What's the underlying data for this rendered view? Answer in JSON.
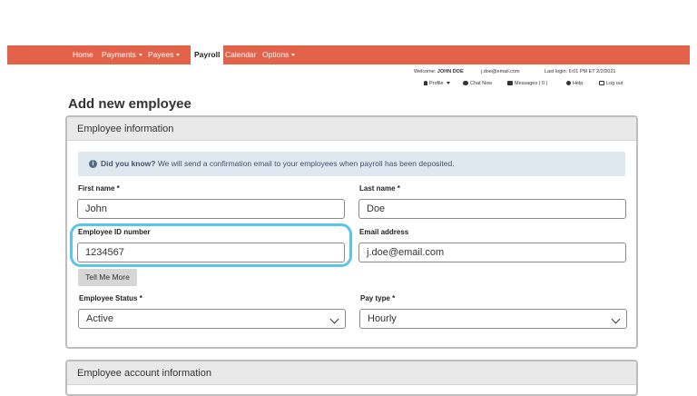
{
  "nav": {
    "home": "Home",
    "payments": "Payments",
    "payees": "Payees",
    "payroll": "Payroll",
    "calendar": "Calendar",
    "options": "Options"
  },
  "util": {
    "welcome_label": "Welcome:",
    "user_name": "JOHN DOE",
    "email": "j.doe@email.com",
    "last_login": "Last login: 6:01 PM ET  2/2/2021",
    "profile": "Profile",
    "chat": "Chat Now",
    "messages": "Messages ( 0 )",
    "help": "Help",
    "logout": "Log out"
  },
  "page": {
    "title": "Add new employee"
  },
  "employee_info": {
    "heading": "Employee information",
    "notice_bold": "Did you know?",
    "notice_text": " We will send a confirmation email to your employees when payroll has been deposited.",
    "first_name_label": "First name  *",
    "first_name_value": "John",
    "last_name_label": "Last name  *",
    "last_name_value": "Doe",
    "employee_id_label": "Employee ID number",
    "employee_id_value": "1234567",
    "email_label": "Email address",
    "email_value": "j.doe@email.com",
    "tell_me_more": "Tell Me More",
    "status_label": "Employee Status *",
    "status_value": "Active",
    "pay_type_label": "Pay type *",
    "pay_type_value": "Hourly"
  },
  "account_info": {
    "heading": "Employee account information"
  },
  "colors": {
    "nav_bg": "#e2624a",
    "highlight": "#58c5ea",
    "notice_bg": "#dfe7ef"
  }
}
